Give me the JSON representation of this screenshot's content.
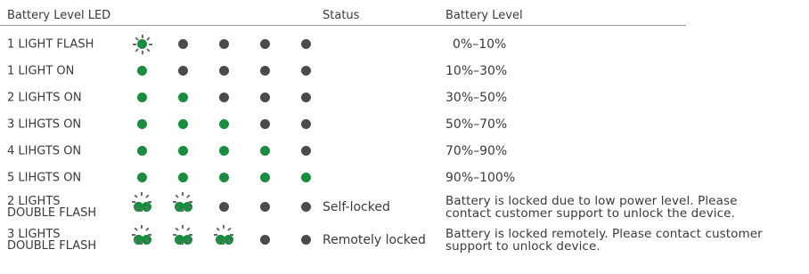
{
  "header": {
    "led_col": "Battery Level LED",
    "status_col": "Status",
    "level_col": "Battery Level"
  },
  "colors": {
    "on": "#1a8c3f",
    "off": "#4b4b4b",
    "rule": "#9a9a9a"
  },
  "rows": [
    {
      "label": "1 LIGHT FLASH",
      "leds": [
        "flash",
        "off",
        "off",
        "off",
        "off"
      ],
      "status": "",
      "level": "0%–10%"
    },
    {
      "label": "1 LIGHT ON",
      "leds": [
        "on",
        "off",
        "off",
        "off",
        "off"
      ],
      "status": "",
      "level": "10%–30%"
    },
    {
      "label": "2 LIGHTS ON",
      "leds": [
        "on",
        "on",
        "off",
        "off",
        "off"
      ],
      "status": "",
      "level": "30%–50%"
    },
    {
      "label": "3 LIHGTS ON",
      "leds": [
        "on",
        "on",
        "on",
        "off",
        "off"
      ],
      "status": "",
      "level": "50%–70%"
    },
    {
      "label": "4 LIHGTS ON",
      "leds": [
        "on",
        "on",
        "on",
        "on",
        "off"
      ],
      "status": "",
      "level": "70%–90%"
    },
    {
      "label": "5 LIHGTS ON",
      "leds": [
        "on",
        "on",
        "on",
        "on",
        "on"
      ],
      "status": "",
      "level": "90%–100%"
    },
    {
      "label_line1": "2 LIGHTS",
      "label_line2": "DOUBLE FLASH",
      "leds": [
        "double",
        "double",
        "off",
        "off",
        "off"
      ],
      "status": "Self-locked",
      "level_line1": "Battery is locked due to low power level. Please",
      "level_line2": "contact customer support to unlock the device."
    },
    {
      "label_line1": "3 LIGHTS",
      "label_line2": "DOUBLE FLASH",
      "leds": [
        "double",
        "double",
        "double",
        "off",
        "off"
      ],
      "status": "Remotely locked",
      "level_line1": "Battery is locked remotely. Please contact customer",
      "level_line2": "support to unlock device."
    }
  ]
}
